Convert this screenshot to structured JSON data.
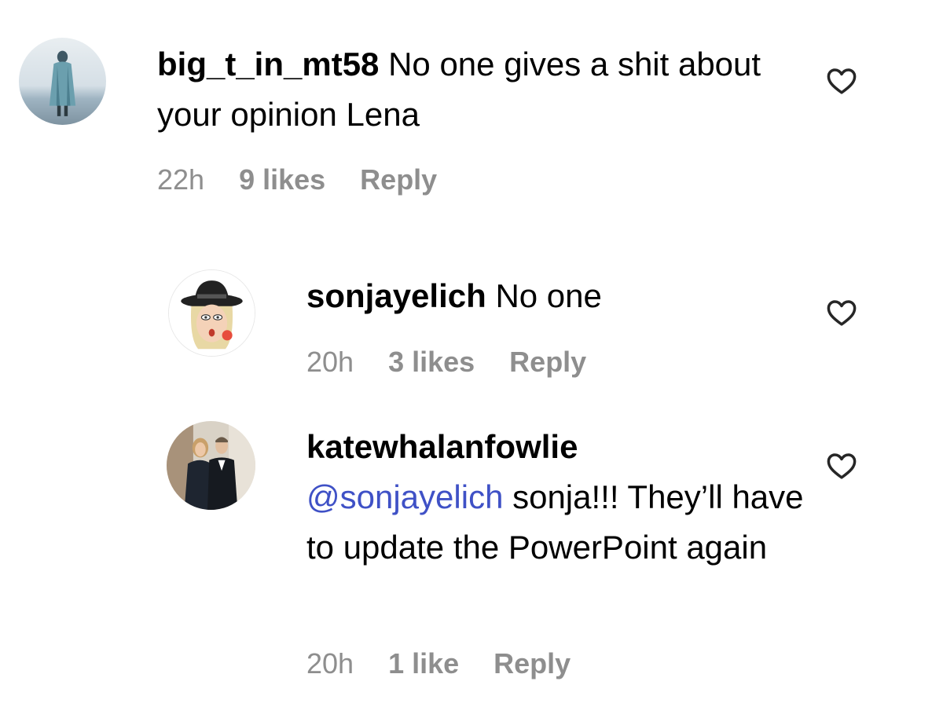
{
  "comments": [
    {
      "username": "big_t_in_mt58",
      "text": "No one gives a shit about your opinion Lena",
      "time": "22h",
      "likes": "9 likes",
      "reply_label": "Reply",
      "avatar_icon": "person-standing-by-water-avatar"
    },
    {
      "username": "sonjayelich",
      "text": "No one",
      "time": "20h",
      "likes": "3 likes",
      "reply_label": "Reply",
      "avatar_icon": "cartoon-woman-in-hat-avatar"
    },
    {
      "username": "katewhalanfowlie",
      "mention": "@sonjayelich",
      "text": "sonja!!! They’ll have to update the PowerPoint again",
      "time": "20h",
      "likes": "1 like",
      "reply_label": "Reply",
      "avatar_icon": "couple-photo-avatar"
    }
  ],
  "icons": {
    "like": "heart-outline-icon"
  },
  "colors": {
    "meta_text": "#8e8e8e",
    "mention": "#3f51c6"
  }
}
